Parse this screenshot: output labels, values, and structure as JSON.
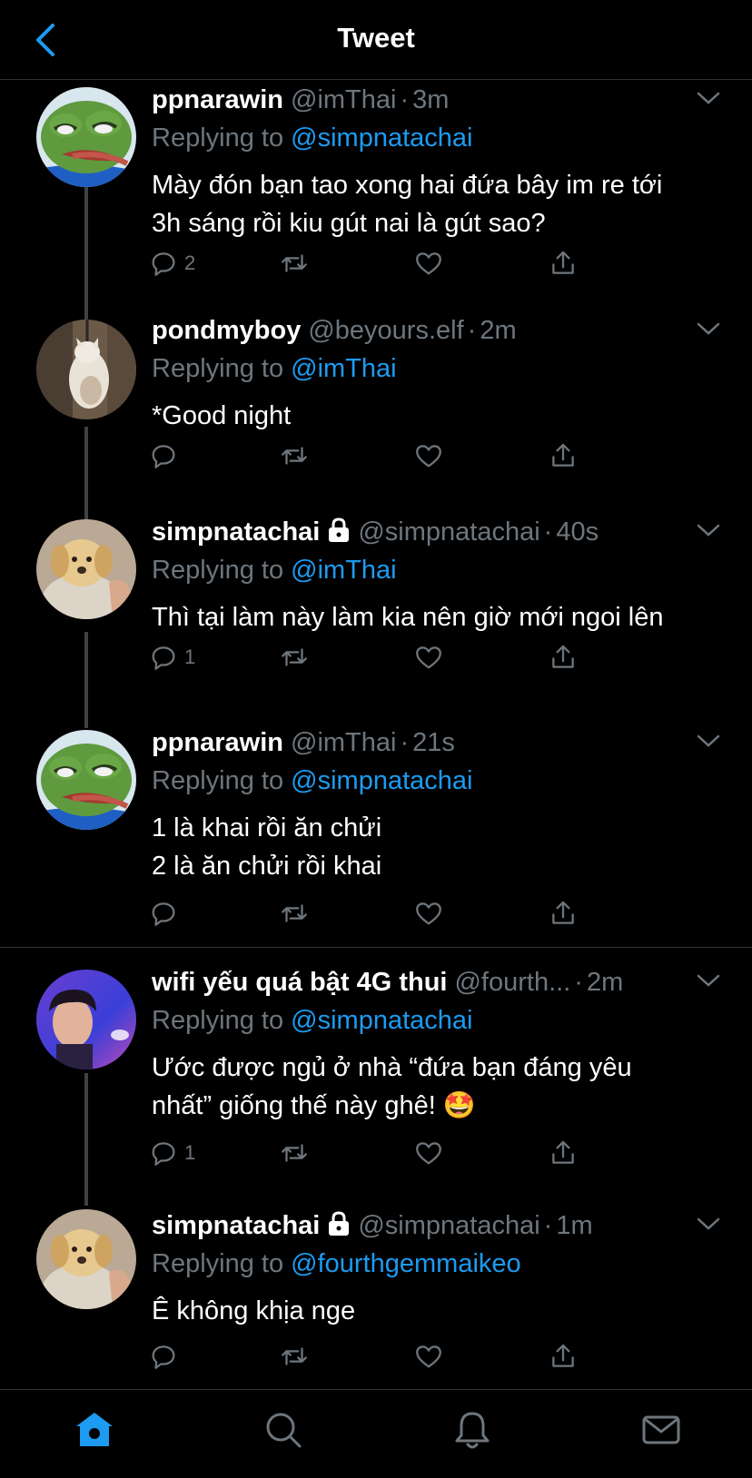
{
  "header": {
    "title": "Tweet",
    "back_icon": "chevron-left-icon",
    "accent": "#1d9bf0"
  },
  "tweets": [
    {
      "name": "ppnarawin",
      "handle": "@imThai",
      "time": "3m",
      "replying_label": "Replying to",
      "replying_to": "@simpnatachai",
      "lines": [
        "Mày đón bạn tao xong hai đứa bây im re tới",
        "3h sáng rồi kiu gút nai là gút sao?"
      ],
      "reply_count": "2",
      "locked": false
    },
    {
      "name": "pondmyboy",
      "handle": "@beyours.elf",
      "time": "2m",
      "replying_label": "Replying to",
      "replying_to": "@imThai",
      "lines": [
        "*Good night"
      ],
      "reply_count": "",
      "locked": false
    },
    {
      "name": "simpnatachai",
      "handle": "@simpnatachai",
      "time": "40s",
      "replying_label": "Replying to",
      "replying_to": "@imThai",
      "lines": [
        "Thì tại làm này làm kia nên giờ mới ngoi lên"
      ],
      "reply_count": "1",
      "locked": true
    },
    {
      "name": "ppnarawin",
      "handle": "@imThai",
      "time": "21s",
      "replying_label": "Replying to",
      "replying_to": "@simpnatachai",
      "lines": [
        "1 là khai rồi ăn chửi",
        "2 là ăn chửi rồi khai"
      ],
      "reply_count": "",
      "locked": false
    },
    {
      "name": "wifi yếu quá bật 4G thui",
      "handle": "@fourth...",
      "time": "2m",
      "replying_label": "Replying to",
      "replying_to": "@simpnatachai",
      "lines": [
        "Ước được ngủ ở nhà “đứa bạn đáng yêu",
        "nhất” giống thế này ghê! 🤩"
      ],
      "reply_count": "1",
      "locked": false
    },
    {
      "name": "simpnatachai",
      "handle": "@simpnatachai",
      "time": "1m",
      "replying_label": "Replying to",
      "replying_to": "@fourthgemmaikeo",
      "lines": [
        "Ê không khịa nge"
      ],
      "reply_count": "",
      "locked": true
    }
  ],
  "bottom_nav": [
    "home-icon",
    "search-icon",
    "notifications-icon",
    "messages-icon"
  ]
}
